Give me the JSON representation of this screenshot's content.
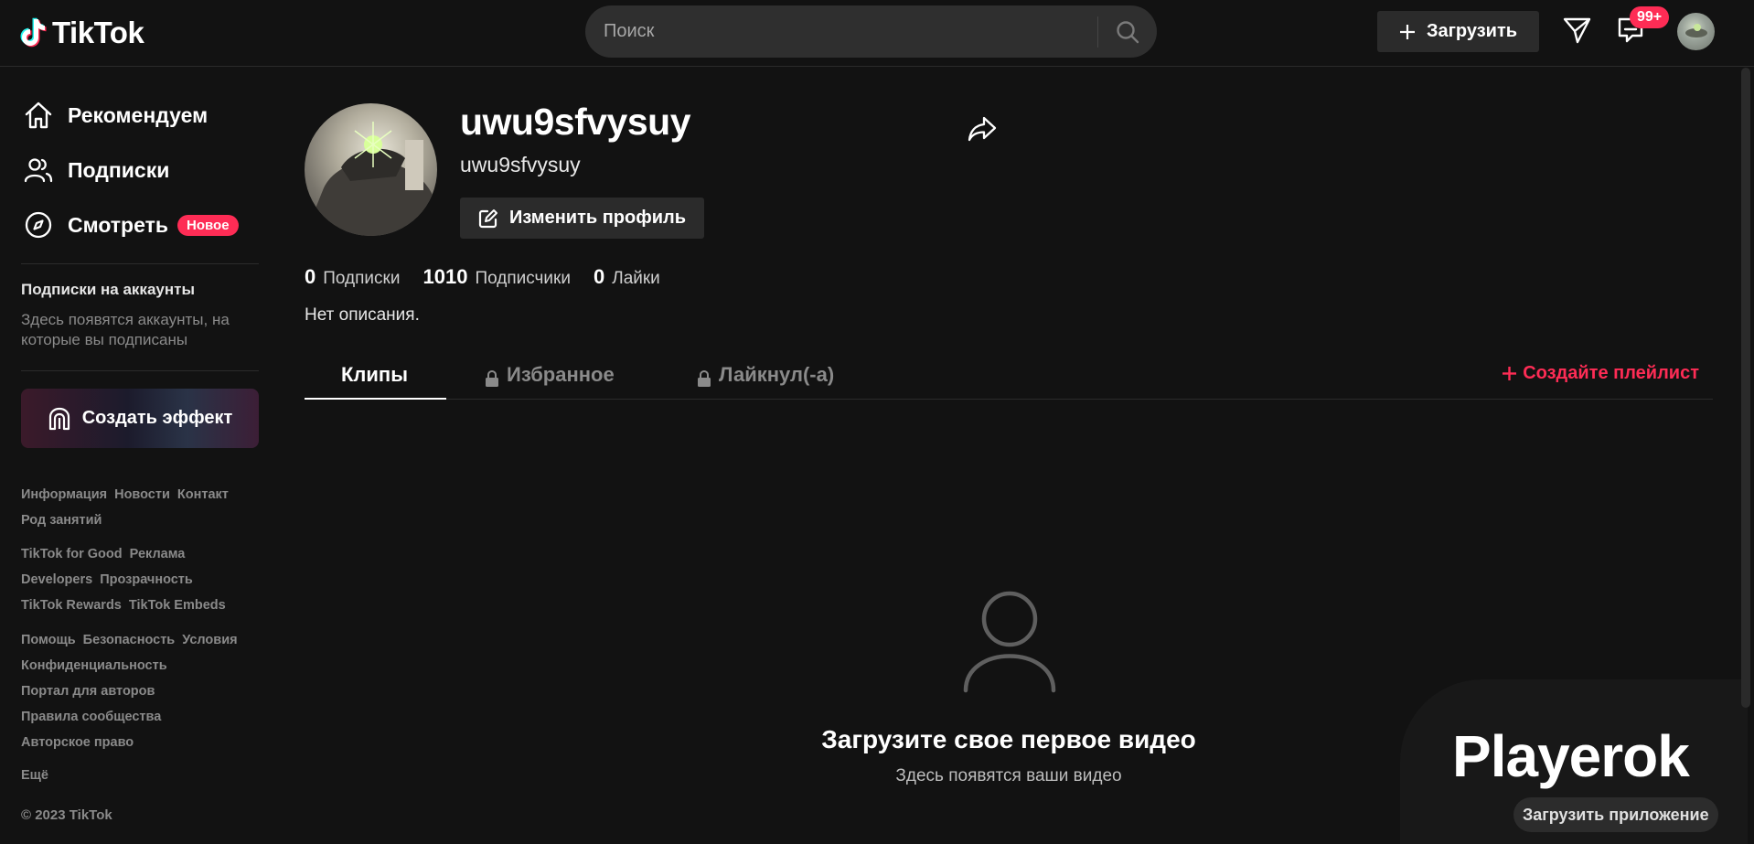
{
  "header": {
    "logo_text": "TikTok",
    "search": {
      "placeholder": "Поиск"
    },
    "upload_label": "Загрузить",
    "inbox_badge": "99+"
  },
  "sidebar": {
    "nav": [
      {
        "label": "Рекомендуем",
        "icon": "home-icon"
      },
      {
        "label": "Подписки",
        "icon": "following-icon"
      },
      {
        "label": "Смотреть",
        "icon": "compass-icon",
        "badge": "Новое"
      }
    ],
    "following_title": "Подписки на аккаунты",
    "following_desc": "Здесь появятся аккаунты, на которые вы подписаны",
    "effect_label": "Создать эффект",
    "footer": {
      "group1": [
        "Информация",
        "Новости",
        "Контакт",
        "Род занятий"
      ],
      "group2": [
        "TikTok for Good",
        "Реклама",
        "Developers",
        "Прозрачность",
        "TikTok Rewards",
        "TikTok Embeds"
      ],
      "group3": [
        "Помощь",
        "Безопасность",
        "Условия",
        "Конфиденциальность",
        "Портал для авторов",
        "Правила сообщества",
        "Авторское право"
      ],
      "more": "Ещё"
    },
    "copyright": "© 2023 TikTok"
  },
  "profile": {
    "username": "uwu9sfvysuy",
    "handle": "uwu9sfvysuy",
    "edit_label": "Изменить профиль",
    "stats": [
      {
        "value": "0",
        "label": "Подписки"
      },
      {
        "value": "1010",
        "label": "Подписчики"
      },
      {
        "value": "0",
        "label": "Лайки"
      }
    ],
    "bio": "Нет описания."
  },
  "tabs": {
    "items": [
      {
        "label": "Клипы",
        "locked": false,
        "active": true
      },
      {
        "label": "Избранное",
        "locked": true,
        "active": false
      },
      {
        "label": "Лайкнул(-а)",
        "locked": true,
        "active": false
      }
    ],
    "playlist_label": "Создайте плейлист"
  },
  "empty_state": {
    "title": "Загрузите свое первое видео",
    "subtitle": "Здесь появятся ваши видео"
  },
  "promo": {
    "word": "Playerok",
    "button_label": "Загрузить приложение"
  },
  "colors": {
    "background": "#121212",
    "accent": "#fe2c55",
    "button_bg": "#2b2b2b",
    "muted_text": "#8a8a8a"
  }
}
